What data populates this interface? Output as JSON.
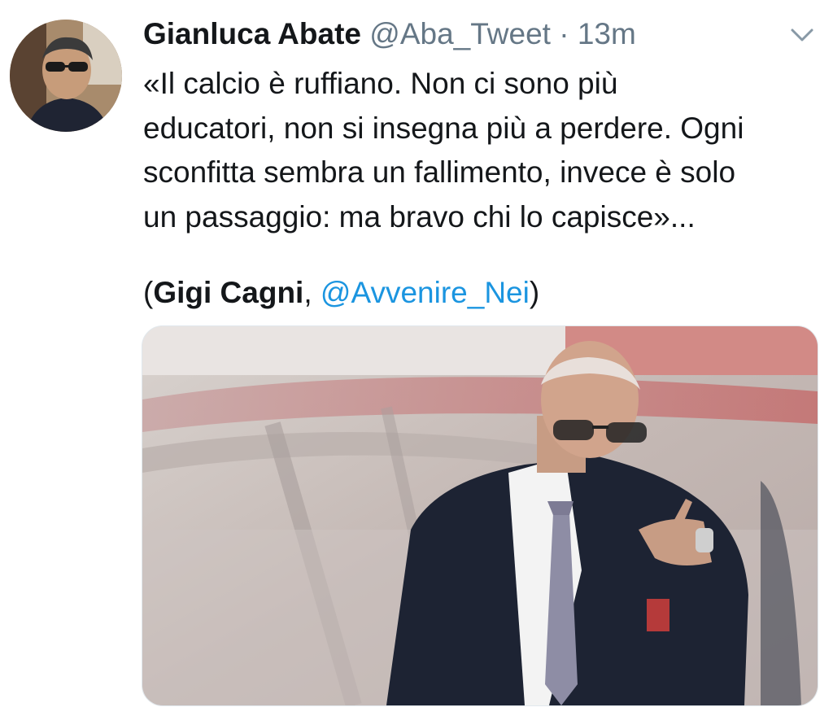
{
  "tweet": {
    "author_name": "Gianluca Abate",
    "handle": "@Aba_Tweet",
    "separator": "·",
    "time": "13m",
    "text_lines": [
      "«Il calcio è ruffiano. Non ci sono più",
      "educatori, non si insegna più a perdere. Ogni",
      "sconfitta sembra un fallimento, invece è solo",
      "un passaggio: ma bravo chi lo capisce»..."
    ],
    "attribution": {
      "open_paren": "(",
      "person": "Gigi Cagni",
      "comma": ", ",
      "mention": "@Avvenire_Nei",
      "close_paren": ")"
    }
  },
  "icons": {
    "menu": "chevron-down-icon",
    "avatar": "profile-photo",
    "media": "photo-man-in-suit-pointing"
  },
  "colors": {
    "text": "#14171a",
    "secondary": "#657786",
    "link": "#1b95e0"
  }
}
